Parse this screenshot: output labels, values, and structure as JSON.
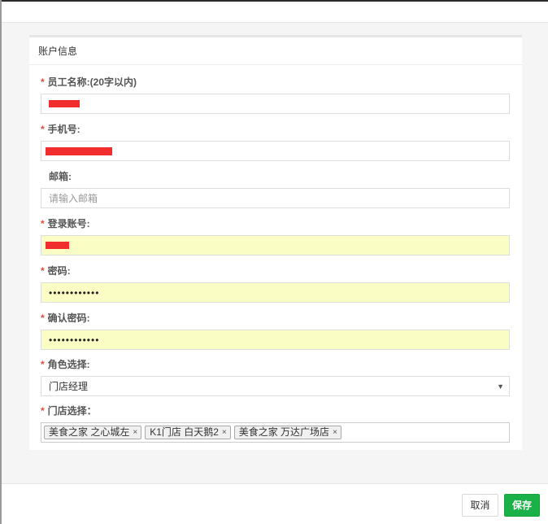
{
  "panel": {
    "title": "账户信息"
  },
  "fields": {
    "name": {
      "label": "员工名称:(20字以内)",
      "required_mark": "*"
    },
    "phone": {
      "label": "手机号:",
      "required_mark": "*"
    },
    "email": {
      "label": "邮箱:",
      "placeholder": "请输入邮箱"
    },
    "account": {
      "label": "登录账号:",
      "required_mark": "*"
    },
    "password": {
      "label": "密码:",
      "required_mark": "*",
      "value": "••••••••••••"
    },
    "confirm": {
      "label": "确认密码:",
      "required_mark": "*",
      "value": "••••••••••••"
    },
    "role": {
      "label": "角色选择:",
      "required_mark": "*",
      "selected": "门店经理"
    },
    "stores": {
      "label": "门店选择：",
      "required_mark": "*",
      "tags": [
        "美食之家 之心城左",
        "K1门店 白天鹅2",
        "美食之家 万达广场店"
      ],
      "tag_remove_glyph": "×"
    }
  },
  "footer": {
    "cancel_label": "取消",
    "save_label": "保存"
  },
  "colors": {
    "save_button": "#1ab248",
    "autofill_bg": "#fafdc4",
    "required": "#e74c3c",
    "redaction": "#f22d2d"
  }
}
